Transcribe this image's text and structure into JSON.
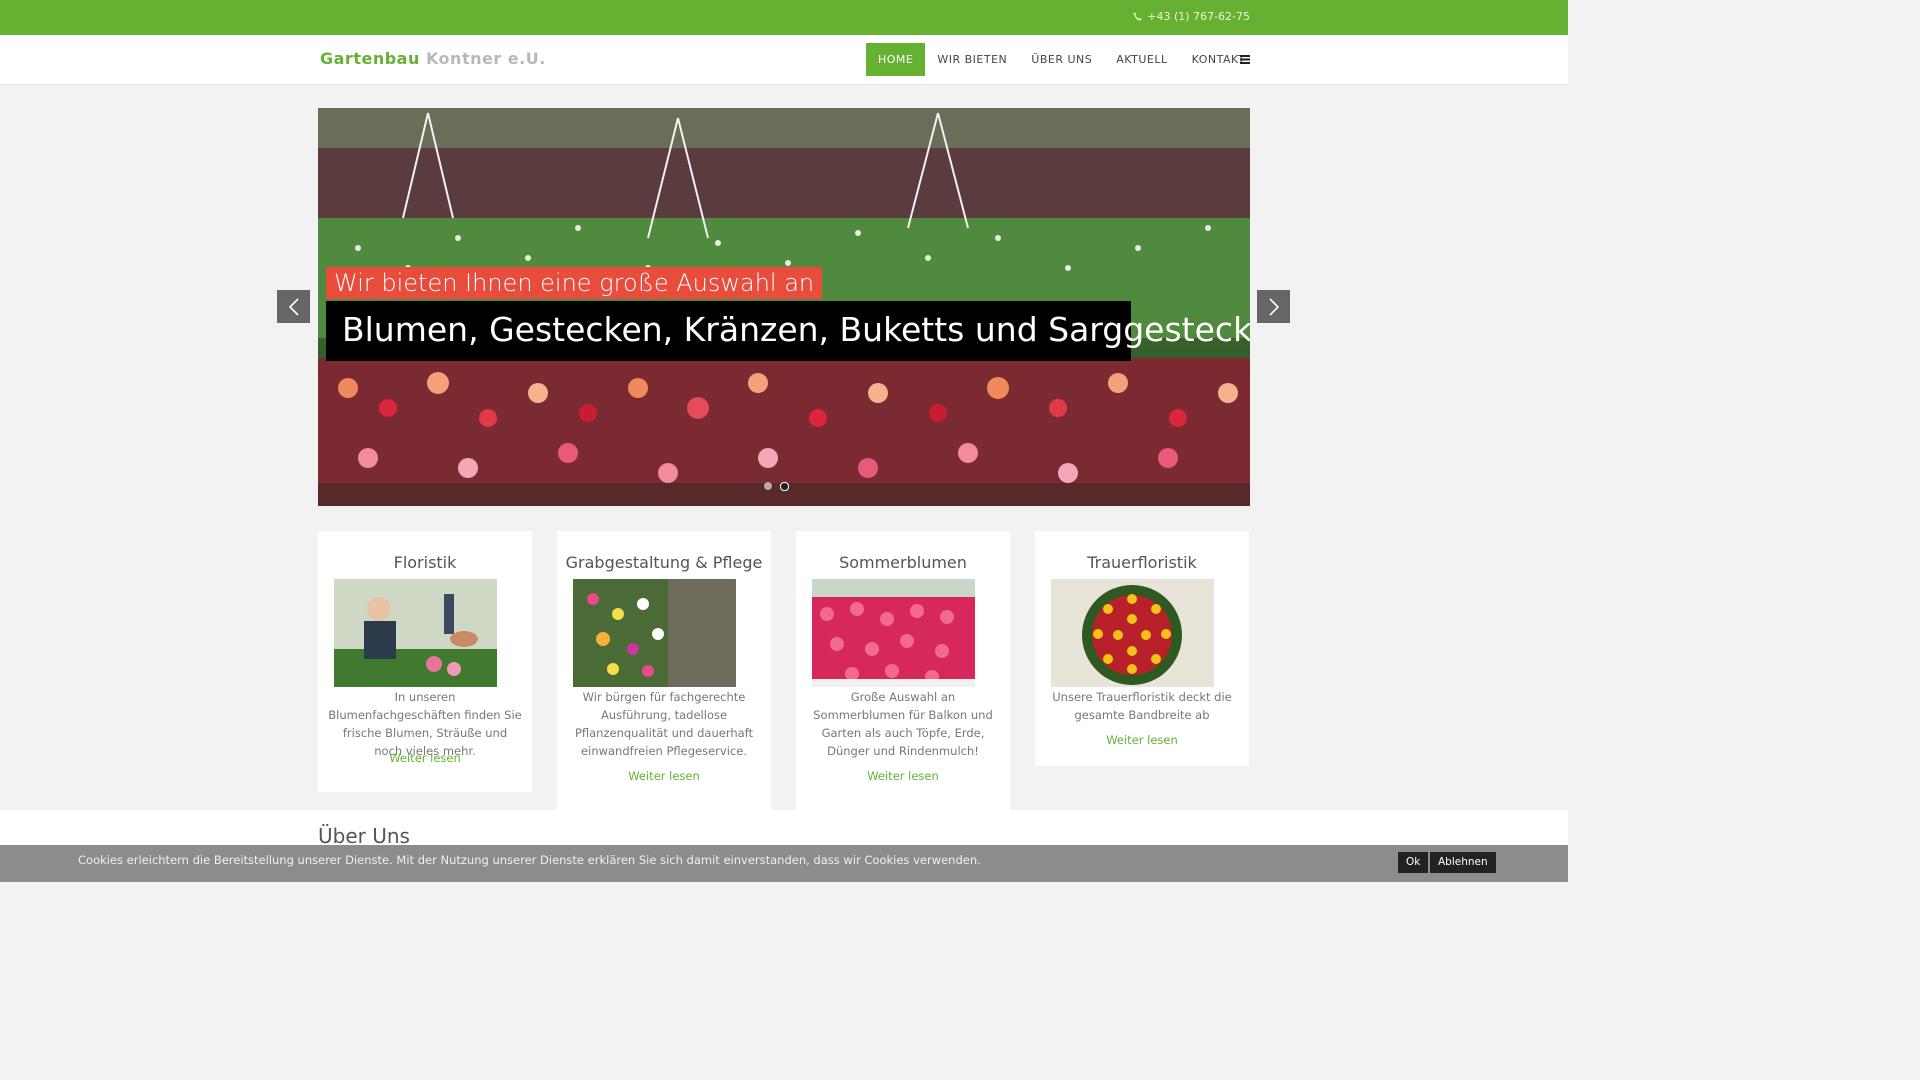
{
  "topbar": {
    "phone": "+43 (1) 767-62-75",
    "phone_icon": "phone-icon"
  },
  "header": {
    "logo_part1": "Gartenbau",
    "logo_part2": "Kontner e.U.",
    "nav": [
      "HOME",
      "WIR BIETEN",
      "ÜBER UNS",
      "AKTUELL",
      "KONTAKT"
    ],
    "active_index": 0,
    "menu_icon": "hamburger-icon"
  },
  "slider": {
    "caption_line1": "Wir bieten Ihnen eine große Auswahl an",
    "caption_line2": "Blumen, Gestecken, Kränzen, Buketts und Sarggestecken",
    "slide_count": 2,
    "active_slide": 1
  },
  "cards": [
    {
      "title": "Floristik",
      "text": "In unseren Blumenfachgeschäften finden Sie frische Blumen, Sträuße und noch vieles mehr.",
      "link": "Weiter lesen"
    },
    {
      "title": "Grabgestaltung & Pflege",
      "text": "Wir bürgen für fachgerechte Ausführung, tadellose Pflanzenqualität und dauerhaft einwandfreien Pflegeservice.",
      "link": "Weiter lesen"
    },
    {
      "title": "Sommerblumen",
      "text": "Große Auswahl an Sommerblumen für Balkon und Garten als auch Töpfe, Erde, Dünger und Rindenmulch!",
      "link": "Weiter lesen"
    },
    {
      "title": "Trauerfloristik",
      "text": "Unsere Trauerfloristik deckt die gesamte Bandbreite ab",
      "link": "Weiter lesen"
    }
  ],
  "section": {
    "heading": "Über Uns"
  },
  "cookie": {
    "text": "Cookies erleichtern die Bereitstellung unserer Dienste. Mit der Nutzung unserer Dienste erklären Sie sich damit einverstanden, dass wir Cookies verwenden.",
    "ok": "Ok",
    "decline": "Ablehnen"
  },
  "colors": {
    "brand_green": "#66b132",
    "caption_red": "#e74c3c"
  }
}
